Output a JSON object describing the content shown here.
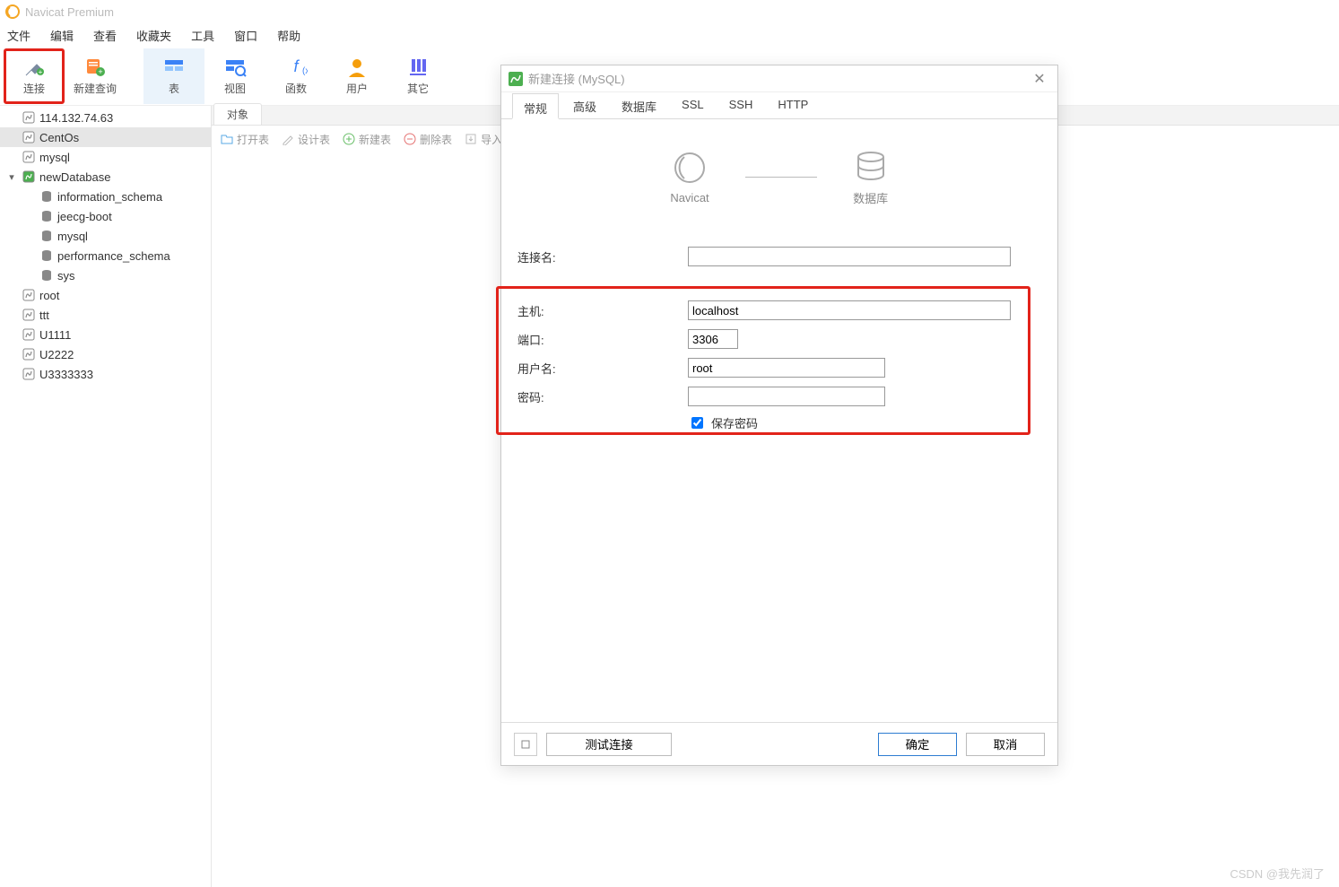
{
  "app": {
    "title": "Navicat Premium"
  },
  "menu": {
    "file": "文件",
    "edit": "编辑",
    "view": "查看",
    "favorites": "收藏夹",
    "tools": "工具",
    "window": "窗口",
    "help": "帮助"
  },
  "toolbar": {
    "connect": "连接",
    "newquery": "新建查询",
    "table": "表",
    "view": "视图",
    "function": "函数",
    "user": "用户",
    "other": "其它"
  },
  "tree": {
    "items": [
      {
        "label": "114.132.74.63",
        "icon": "conn"
      },
      {
        "label": "CentOs",
        "icon": "conn",
        "selected": true
      },
      {
        "label": "mysql",
        "icon": "conn"
      },
      {
        "label": "newDatabase",
        "icon": "conn-open",
        "expanded": true,
        "children": [
          {
            "label": "information_schema",
            "icon": "db"
          },
          {
            "label": "jeecg-boot",
            "icon": "db"
          },
          {
            "label": "mysql",
            "icon": "db"
          },
          {
            "label": "performance_schema",
            "icon": "db"
          },
          {
            "label": "sys",
            "icon": "db"
          }
        ]
      },
      {
        "label": "root",
        "icon": "conn"
      },
      {
        "label": "ttt",
        "icon": "conn"
      },
      {
        "label": "U1111",
        "icon": "conn"
      },
      {
        "label": "U2222",
        "icon": "conn"
      },
      {
        "label": "U3333333",
        "icon": "conn"
      }
    ]
  },
  "objects": {
    "tab": "对象",
    "toolbar": {
      "open": "打开表",
      "design": "设计表",
      "new": "新建表",
      "delete": "删除表",
      "import": "导入"
    }
  },
  "dialog": {
    "title": "新建连接 (MySQL)",
    "tabs": {
      "general": "常规",
      "advanced": "高级",
      "database": "数据库",
      "ssl": "SSL",
      "ssh": "SSH",
      "http": "HTTP"
    },
    "graphic": {
      "navicat": "Navicat",
      "database": "数据库"
    },
    "fields": {
      "conn_name_label": "连接名:",
      "conn_name": "",
      "host_label": "主机:",
      "host": "localhost",
      "port_label": "端口:",
      "port": "3306",
      "user_label": "用户名:",
      "user": "root",
      "password_label": "密码:",
      "password": "",
      "save_password_label": "保存密码",
      "save_password": true
    },
    "footer": {
      "test": "测试连接",
      "ok": "确定",
      "cancel": "取消"
    }
  },
  "watermark": "CSDN @我先润了"
}
